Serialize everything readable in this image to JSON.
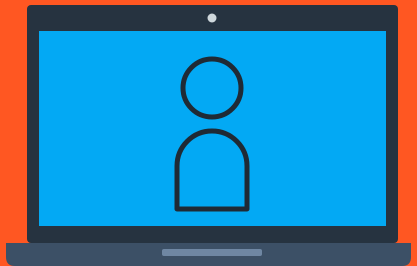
{
  "illustration": {
    "subject": "laptop-user-profile",
    "icons": [
      "laptop-icon",
      "webcam-icon",
      "user-icon",
      "trackpad-icon"
    ]
  },
  "colors": {
    "background": "#ff5722",
    "bezel": "#263340",
    "screen": "#03a9f4",
    "base": "#3c5066",
    "trackpad": "#6f87a3",
    "webcam": "#cfd8dc",
    "user_outline": "#1f2a35"
  }
}
